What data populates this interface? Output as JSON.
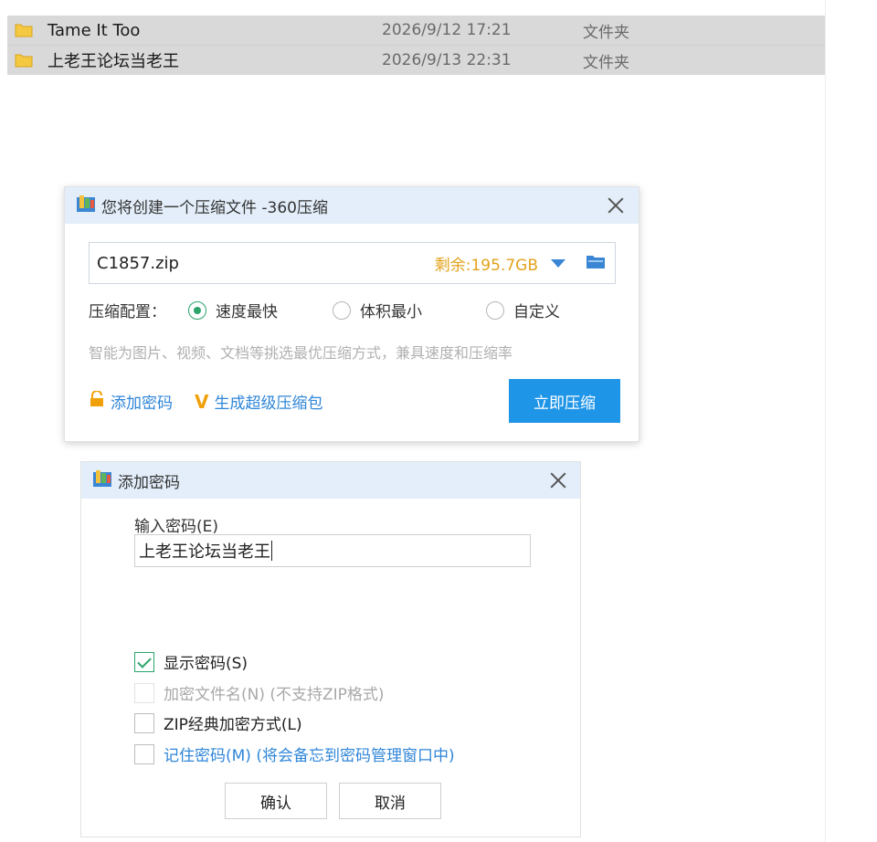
{
  "files": [
    {
      "name": "Tame It Too",
      "date": "2026/9/12 17:21",
      "type": "文件夹"
    },
    {
      "name": "上老王论坛当老王",
      "date": "2026/9/13 22:31",
      "type": "文件夹"
    }
  ],
  "compress_dialog": {
    "title": "您将创建一个压缩文件 -360压缩",
    "filename": "C1857.zip",
    "free_space": "剩余:195.7GB",
    "config_label": "压缩配置：",
    "options": [
      "速度最快",
      "体积最小",
      "自定义"
    ],
    "selected_option": "速度最快",
    "hint": "智能为图片、视频、文档等挑选最优压缩方式，兼具速度和压缩率",
    "add_password_link": "添加密码",
    "super_pack_link": "生成超级压缩包",
    "compress_button": "立即压缩"
  },
  "password_dialog": {
    "title": "添加密码",
    "input_label": "输入密码(E)",
    "password_value": "上老王论坛当老王",
    "checkboxes": [
      {
        "label": "显示密码(S)",
        "checked": true,
        "enabled": true
      },
      {
        "label": "加密文件名(N) (不支持ZIP格式)",
        "checked": false,
        "enabled": false
      },
      {
        "label": "ZIP经典加密方式(L)",
        "checked": false,
        "enabled": true
      },
      {
        "label": "记住密码(M) (将会备忘到密码管理窗口中)",
        "checked": false,
        "enabled": true
      }
    ],
    "ok_button": "确认",
    "cancel_button": "取消"
  },
  "colors": {
    "primary_button": "#1f95e8",
    "link": "#2f86d8",
    "free_space": "#e2a21c",
    "checked_green": "#2aa46b",
    "titlebar": "#e3eefa",
    "selected_row": "#d9d9d9"
  }
}
